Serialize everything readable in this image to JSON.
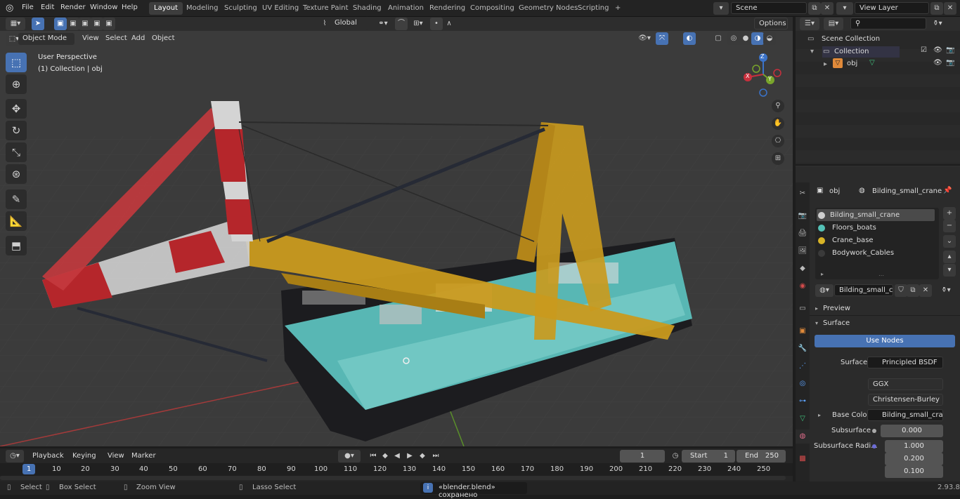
{
  "topbar": {
    "menus": [
      "File",
      "Edit",
      "Render",
      "Window",
      "Help"
    ],
    "workspaces": [
      "Layout",
      "Modeling",
      "Sculpting",
      "UV Editing",
      "Texture Paint",
      "Shading",
      "Animation",
      "Rendering",
      "Compositing",
      "Geometry Nodes",
      "Scripting"
    ],
    "add_tab": "+",
    "scene": "Scene",
    "view_layer": "View Layer"
  },
  "header3d": {
    "mode": "Object Mode",
    "menus": [
      "View",
      "Select",
      "Add",
      "Object"
    ],
    "transform": "Global",
    "options": "Options"
  },
  "viewport": {
    "perspective": "User Perspective",
    "collection": "(1) Collection | obj",
    "gizmo": {
      "x": "X",
      "y": "Y",
      "z": "Z"
    }
  },
  "outliner": {
    "scene_collection": "Scene Collection",
    "collection": "Collection",
    "object": "obj"
  },
  "properties": {
    "object": "obj",
    "material": "Bilding_small_crane",
    "slots": [
      {
        "name": "Bilding_small_crane",
        "color": "#cfcfcf"
      },
      {
        "name": "Floors_boats",
        "color": "#54c1b6"
      },
      {
        "name": "Crane_base",
        "color": "#d8b427"
      },
      {
        "name": "Bodywork_Cables",
        "color": "#3a3a3a"
      }
    ],
    "mat_field": "Bilding_small_cra...",
    "preview": "Preview",
    "surface_panel": "Surface",
    "use_nodes": "Use Nodes",
    "surface_label": "Surface",
    "surface_value": "Principled BSDF",
    "distribution": "GGX",
    "subsurface_method": "Christensen-Burley",
    "base_color_label": "Base Color",
    "base_color_value": "Bilding_small_crane...",
    "subsurface_label": "Subsurface",
    "subsurface_value": "0.000",
    "subsurface_radius_label": "Subsurface Radi...",
    "radius": [
      "1.000",
      "0.200",
      "0.100"
    ]
  },
  "timeline": {
    "menus": [
      "Playback",
      "Keying",
      "View",
      "Marker"
    ],
    "current_frame": "1",
    "start_label": "Start",
    "start": "1",
    "end_label": "End",
    "end": "250",
    "ticks": [
      "1",
      "10",
      "20",
      "30",
      "40",
      "50",
      "60",
      "70",
      "80",
      "90",
      "100",
      "110",
      "120",
      "130",
      "140",
      "150",
      "160",
      "170",
      "180",
      "190",
      "200",
      "210",
      "220",
      "230",
      "240",
      "250"
    ]
  },
  "status": {
    "select": "Select",
    "box_select": "Box Select",
    "zoom_view": "Zoom View",
    "lasso_select": "Lasso Select",
    "message": "«blender.blend» сохранено",
    "version": "2.93.8"
  },
  "colors": {
    "accent": "#4772b3",
    "crane_red": "#b5262b",
    "crane_yellow": "#c99a1e",
    "deck_teal": "#5fc9c4"
  }
}
